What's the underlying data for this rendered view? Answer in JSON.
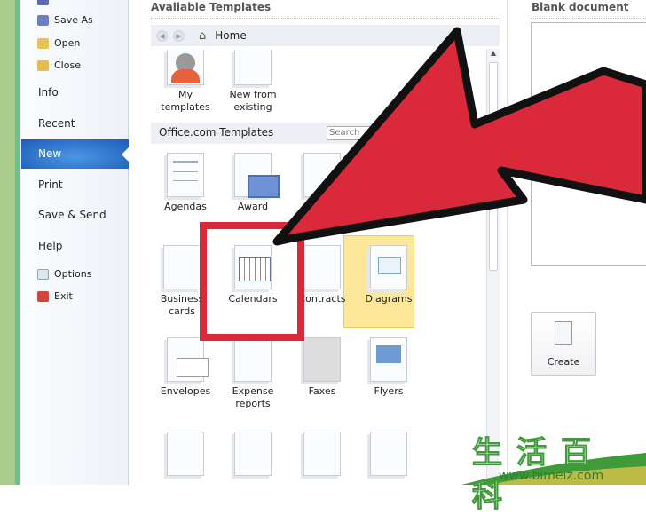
{
  "sidebar": {
    "items": [
      {
        "label": "Save As",
        "icon": "save-as-icon"
      },
      {
        "label": "Open",
        "icon": "open-folder-icon"
      },
      {
        "label": "Close",
        "icon": "close-folder-icon"
      },
      {
        "label": "Info"
      },
      {
        "label": "Recent"
      },
      {
        "label": "New",
        "selected": true
      },
      {
        "label": "Print"
      },
      {
        "label": "Save & Send"
      },
      {
        "label": "Help"
      },
      {
        "label": "Options",
        "icon": "options-icon"
      },
      {
        "label": "Exit",
        "icon": "exit-icon"
      }
    ]
  },
  "main": {
    "title": "Available Templates",
    "nav": {
      "location": "Home"
    },
    "top_templates": [
      {
        "label": "My templates"
      },
      {
        "label": "New from existing"
      }
    ],
    "section": "Office.com Templates",
    "search_placeholder": "Search",
    "templates": [
      {
        "label": "Agendas"
      },
      {
        "label": "Award"
      },
      {
        "label": "Business cards"
      },
      {
        "label": "Calendars",
        "selected": true
      },
      {
        "label": "Contracts"
      },
      {
        "label": "Diagrams"
      },
      {
        "label": "Envelopes"
      },
      {
        "label": "Expense reports"
      },
      {
        "label": "Faxes"
      },
      {
        "label": "Flyers"
      }
    ]
  },
  "right": {
    "title": "Blank document",
    "create_label": "Create"
  },
  "annotation": {
    "arrow_color": "#d9293a",
    "highlight_color": "#d9293a"
  },
  "watermark": {
    "text": "生活百科",
    "url": "www.bimeiz.com"
  }
}
